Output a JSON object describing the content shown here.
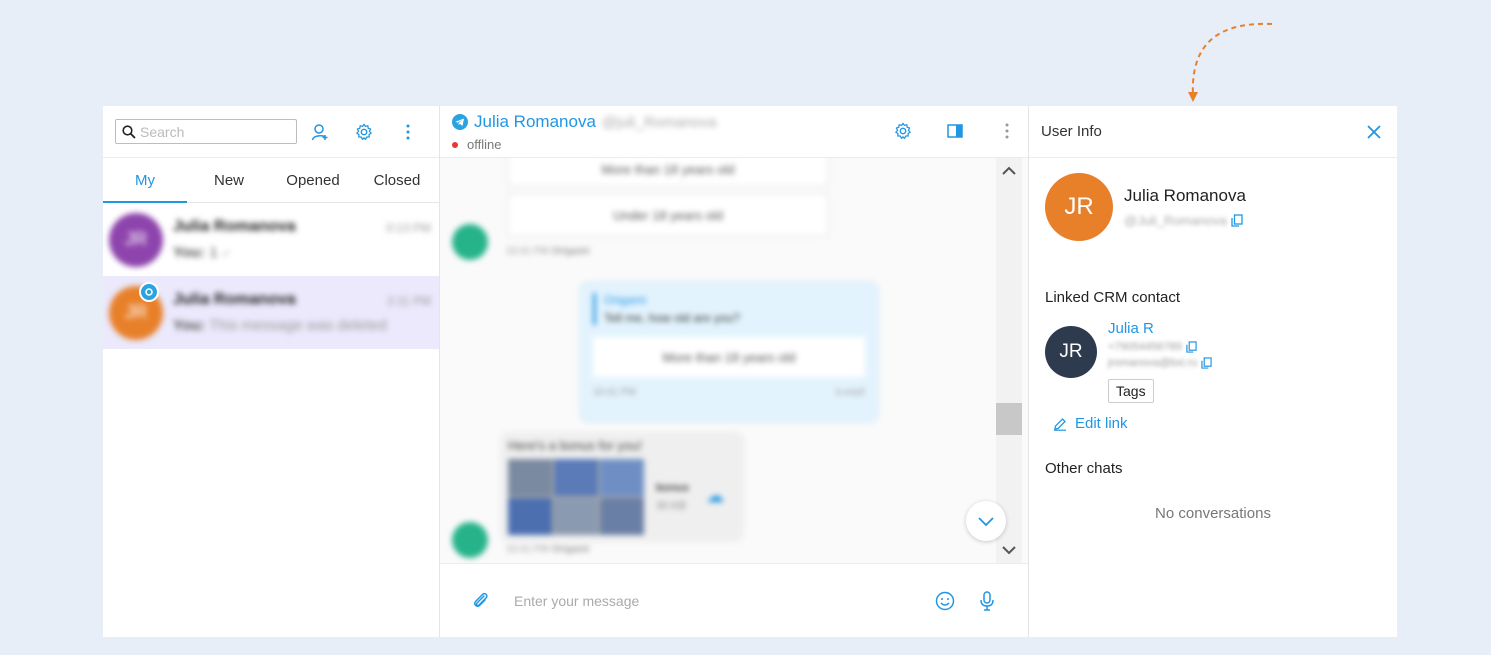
{
  "search": {
    "placeholder": "Search"
  },
  "tabs": [
    "My",
    "New",
    "Opened",
    "Closed"
  ],
  "chats": [
    {
      "initials": "JR",
      "name": "Julia Romanova",
      "time": "0:13 PM",
      "prefix": "You:",
      "message": "1",
      "avatar_color": "#8e44ad"
    },
    {
      "initials": "JR",
      "name": "Julia Romanova",
      "time": "2:11 PM",
      "prefix": "You:",
      "message": "This message was deleted",
      "avatar_color": "#e8802a"
    }
  ],
  "conversation": {
    "name": "Julia Romanova",
    "handle": "@juli_Romanova",
    "status": "offline",
    "messages": {
      "opt1": "More than 18 years old",
      "opt2": "Under 18 years old",
      "time1": "10:41 PM",
      "sender": "Origami",
      "quote_author": "Origami",
      "quote_text": "Tell me, how old are you?",
      "reply": "More than 18 years old",
      "time2": "10:41 PM",
      "time2_right": "в клуб",
      "bonus_text": "Here's a bonus for you!",
      "file_name": "bonus",
      "file_size": "30 KB",
      "time3": "10:41 PM"
    }
  },
  "composer": {
    "placeholder": "Enter your message"
  },
  "user_info": {
    "title": "User Info",
    "initials": "JR",
    "name": "Julia Romanova",
    "handle": "@Juli_Romanova",
    "linked_title": "Linked CRM contact",
    "crm": {
      "initials": "JR",
      "name": "Julia R",
      "phone": "+79054456789",
      "email": "jromanova@bxi.ru",
      "tags": "Tags"
    },
    "edit_link": "Edit link",
    "other_chats": "Other chats",
    "no_conversations": "No conversations"
  },
  "colors": {
    "accent": "#2196e3",
    "bg": "#e7eef7",
    "arrow": "#e8802a"
  }
}
